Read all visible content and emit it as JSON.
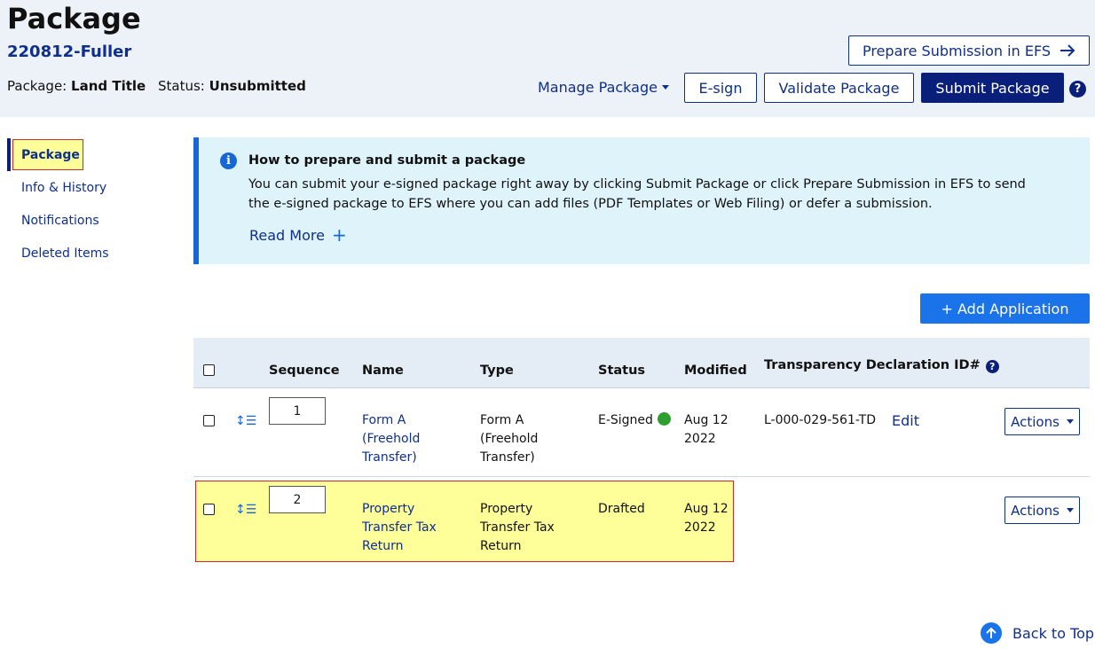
{
  "header": {
    "title": "Package",
    "package_id": "220812-Fuller",
    "package_label": "Package:",
    "package_value": "Land Title",
    "status_label": "Status:",
    "status_value": "Unsubmitted",
    "prepare_efs_label": "Prepare Submission in EFS",
    "manage_label": "Manage Package",
    "esign_label": "E-sign",
    "validate_label": "Validate Package",
    "submit_label": "Submit Package",
    "help_glyph": "?"
  },
  "sidebar": {
    "items": [
      {
        "label": "Package",
        "active": true
      },
      {
        "label": "Info & History"
      },
      {
        "label": "Notifications"
      },
      {
        "label": "Deleted Items"
      }
    ]
  },
  "alert": {
    "icon_glyph": "i",
    "title": "How to prepare and submit a package",
    "body": "You can submit your e-signed package right away by clicking Submit Package or click Prepare Submission in EFS to send the e-signed package to EFS where you can add files (PDF Templates or Web Filing) or defer a submission.",
    "read_more": "Read More",
    "plus_glyph": "+"
  },
  "add_application_label": "+ Add Application",
  "table": {
    "headers": {
      "sequence": "Sequence",
      "name": "Name",
      "type": "Type",
      "status": "Status",
      "modified": "Modified",
      "transparency": "Transparency Declaration ID#"
    },
    "rows": [
      {
        "sequence": "1",
        "name": "Form A (Freehold Transfer)",
        "type": "Form A (Freehold Transfer)",
        "status": "E-Signed",
        "modified": "Aug 12 2022",
        "transparency_id": "L-000-029-561-TD",
        "edit": "Edit",
        "actions": "Actions"
      },
      {
        "sequence": "2",
        "name": "Property Transfer Tax Return",
        "type": "Property Transfer Tax Return",
        "status": "Drafted",
        "modified": "Aug 12 2022",
        "transparency_id": "",
        "edit": "",
        "actions": "Actions"
      }
    ],
    "reorder_glyph": "↕☰"
  },
  "back_to_top": "Back to Top",
  "colors": {
    "navy": "#0a1f7a",
    "link": "#0e2f8a",
    "accent_blue": "#1a73e8",
    "alert_bg": "#dff3fb",
    "highlight": "#ffff99",
    "highlight_border": "#cc2b2b",
    "esigned_dot": "#2e9e2e"
  },
  "icons": [
    "arrow-right-icon",
    "caret-down-icon",
    "help-icon",
    "info-icon",
    "plus-icon",
    "reorder-icon",
    "status-dot-icon",
    "arrow-up-icon"
  ]
}
